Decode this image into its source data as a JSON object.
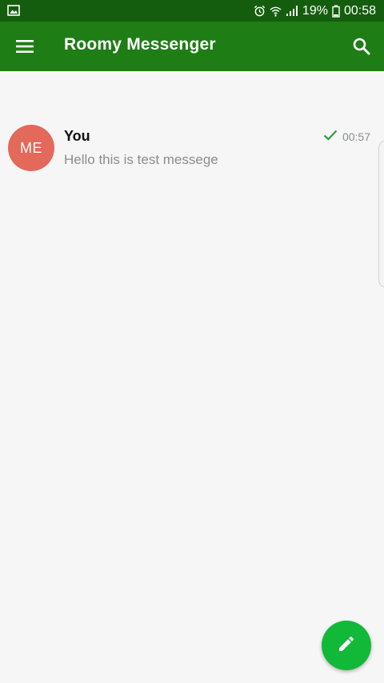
{
  "status_bar": {
    "battery_percent": "19%",
    "time": "00:58"
  },
  "app_bar": {
    "title": "Roomy Messenger",
    "menu_icon": "hamburger-menu-icon",
    "search_icon": "search-icon"
  },
  "conversations": [
    {
      "avatar_initials": "ME",
      "avatar_color": "#e3695a",
      "name": "You",
      "preview": "Hello this is test messege",
      "time": "00:57",
      "status_icon": "check-icon"
    }
  ],
  "fab": {
    "icon": "pencil-icon",
    "color": "#12b838"
  },
  "colors": {
    "status_bar": "#155d0e",
    "app_bar": "#1e7d15",
    "accent_check": "#2e9e3a"
  }
}
